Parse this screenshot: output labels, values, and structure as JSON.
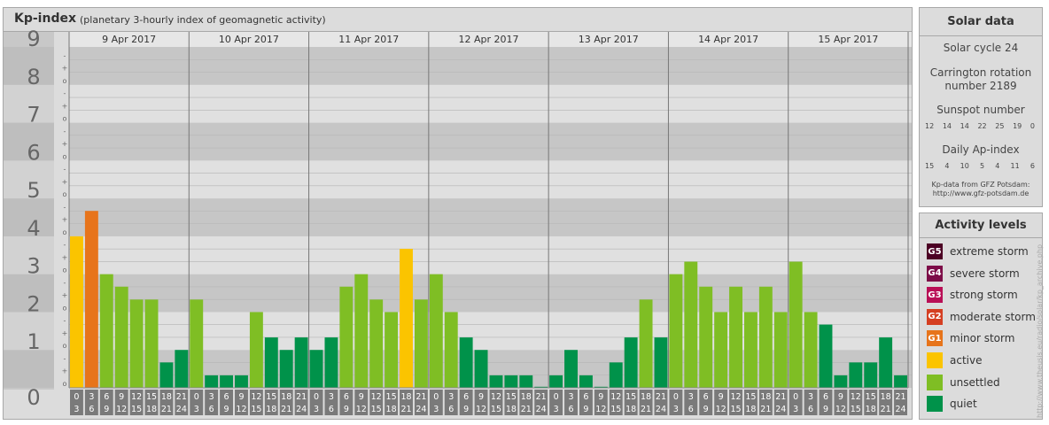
{
  "header": {
    "title": "Kp-index",
    "subtitle": "(planetary 3-hourly index of geomagnetic activity)"
  },
  "chart_data": {
    "type": "bar",
    "title": "Kp-index",
    "subtitle": "(planetary 3-hourly index of geomagnetic activity)",
    "ylim": [
      0,
      9
    ],
    "y_ticks": [
      "0",
      "1",
      "2",
      "3",
      "4",
      "5",
      "6",
      "7",
      "8",
      "9"
    ],
    "minor_ticks": [
      "o",
      "+",
      "-"
    ],
    "days": [
      "9 Apr 2017",
      "10 Apr 2017",
      "11 Apr 2017",
      "12 Apr 2017",
      "13 Apr 2017",
      "14 Apr 2017",
      "15 Apr 2017"
    ],
    "interval_labels": [
      [
        "0",
        "3"
      ],
      [
        "3",
        "6"
      ],
      [
        "6",
        "9"
      ],
      [
        "9",
        "12"
      ],
      [
        "12",
        "15"
      ],
      [
        "15",
        "18"
      ],
      [
        "18",
        "21"
      ],
      [
        "21",
        "24"
      ]
    ],
    "values": [
      [
        4.0,
        4.67,
        3.0,
        2.67,
        2.33,
        2.33,
        0.67,
        1.0
      ],
      [
        2.33,
        0.33,
        0.33,
        0.33,
        2.0,
        1.33,
        1.0,
        1.33
      ],
      [
        1.0,
        1.33,
        2.67,
        3.0,
        2.33,
        2.0,
        3.67,
        2.33
      ],
      [
        3.0,
        2.0,
        1.33,
        1.0,
        0.33,
        0.33,
        0.33,
        0.0
      ],
      [
        0.33,
        1.0,
        0.33,
        0.0,
        0.67,
        1.33,
        2.33,
        1.33
      ],
      [
        3.0,
        3.33,
        2.67,
        2.0,
        2.67,
        2.0,
        2.67,
        2.0
      ],
      [
        3.33,
        2.0,
        1.67,
        0.33,
        0.67,
        0.67,
        1.33,
        0.33
      ]
    ],
    "colors": {
      "quiet": "#00924a",
      "unsettled": "#7fbe24",
      "active": "#fbc400",
      "G1": "#e7741b",
      "G2": "#d53f22",
      "G3": "#b90f56",
      "G4": "#7d0d48",
      "G5": "#4c0024"
    },
    "grid": true
  },
  "solar": {
    "title": "Solar data",
    "cycle": "Solar cycle 24",
    "carrington_1": "Carrington rotation",
    "carrington_2": "number 2189",
    "sunspot_label": "Sunspot number",
    "sunspot_values": [
      "12",
      "14",
      "14",
      "22",
      "25",
      "19",
      "0"
    ],
    "ap_label": "Daily Ap-index",
    "ap_values": [
      "15",
      "4",
      "10",
      "5",
      "4",
      "11",
      "6"
    ],
    "source_1": "Kp-data from GFZ Potsdam:",
    "source_2": "http://www.gfz-potsdam.de"
  },
  "activity": {
    "title": "Activity levels",
    "items": [
      {
        "badge": "G5",
        "label": "extreme storm",
        "color": "#4c0024"
      },
      {
        "badge": "G4",
        "label": "severe storm",
        "color": "#7d0d48"
      },
      {
        "badge": "G3",
        "label": "strong storm",
        "color": "#b90f56"
      },
      {
        "badge": "G2",
        "label": "moderate storm",
        "color": "#d53f22"
      },
      {
        "badge": "G1",
        "label": "minor storm",
        "color": "#e7741b"
      },
      {
        "badge": "",
        "label": "active",
        "color": "#fbc400"
      },
      {
        "badge": "",
        "label": "unsettled",
        "color": "#7fbe24"
      },
      {
        "badge": "",
        "label": "quiet",
        "color": "#00924a"
      }
    ]
  },
  "credit": "http://www.theusis.eu/radio/solar/kp_archive.php"
}
